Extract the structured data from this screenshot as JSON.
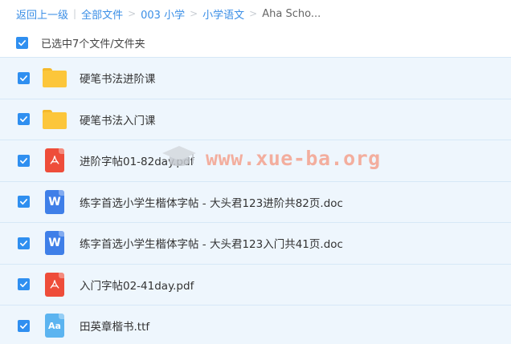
{
  "breadcrumb": {
    "back": "返回上一级",
    "all_files": "全部文件",
    "level1": "003 小学",
    "level2": "小学语文",
    "current": "Aha Scho..."
  },
  "selection": {
    "summary": "已选中7个文件/文件夹",
    "checked": true
  },
  "files": [
    {
      "name": "硬笔书法进阶课",
      "type": "folder-icon"
    },
    {
      "name": "硬笔书法入门课",
      "type": "folder-icon"
    },
    {
      "name": "进阶字帖01-82day.pdf",
      "type": "pdf-icon"
    },
    {
      "name": "练字首选小学生楷体字帖 - 大头君123进阶共82页.doc",
      "type": "word-icon",
      "icon_text": "W"
    },
    {
      "name": "练字首选小学生楷体字帖 - 大头君123入门共41页.doc",
      "type": "word-icon",
      "icon_text": "W"
    },
    {
      "name": "入门字帖02-41day.pdf",
      "type": "pdf-icon"
    },
    {
      "name": "田英章楷书.ttf",
      "type": "font-file-icon",
      "icon_text": "Aa"
    }
  ],
  "watermark": {
    "text": "www.xue-ba.org"
  },
  "colors": {
    "accent": "#2f8ff0",
    "link": "#3a8ee6",
    "row_bg": "#eef6fd",
    "folder": "#fcc63a",
    "pdf": "#ee4d3a",
    "word": "#3f7fe8",
    "ttf": "#5cb4f0"
  }
}
